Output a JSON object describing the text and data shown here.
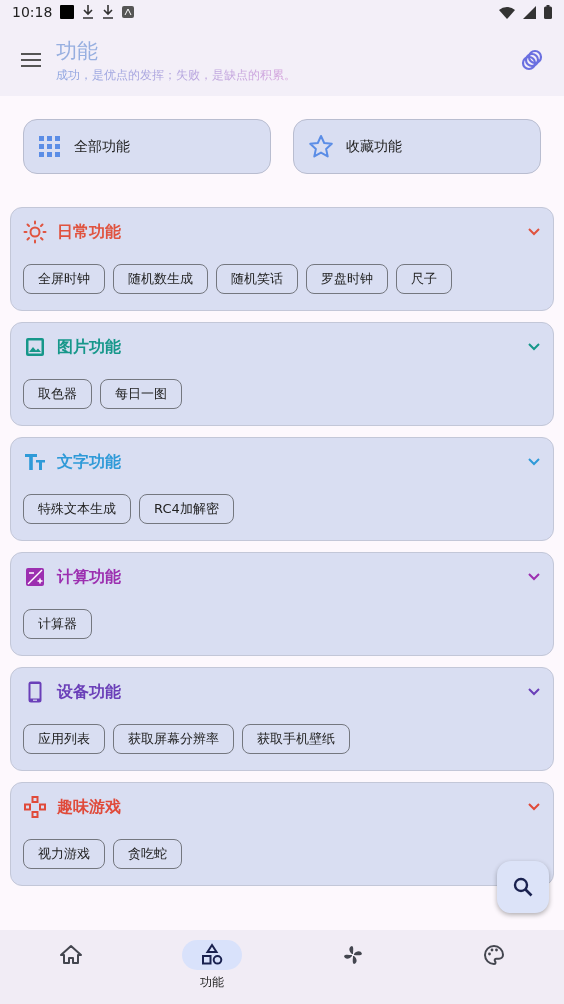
{
  "status_bar": {
    "time": "10:18"
  },
  "header": {
    "title": "功能",
    "subtitle": "成功，是优点的发挥；失败，是缺点的积累。"
  },
  "top_buttons": [
    {
      "kind": "grid",
      "label": "全部功能"
    },
    {
      "kind": "star",
      "label": "收藏功能"
    }
  ],
  "categories": [
    {
      "kind": "sun",
      "title": "日常功能",
      "color": "#e0533f",
      "expanded": true,
      "items": [
        "全屏时钟",
        "随机数生成",
        "随机笑话",
        "罗盘时钟",
        "尺子"
      ]
    },
    {
      "kind": "image",
      "title": "图片功能",
      "color": "#16978a",
      "expanded": true,
      "items": [
        "取色器",
        "每日一图"
      ]
    },
    {
      "kind": "text",
      "title": "文字功能",
      "color": "#2f9ad8",
      "expanded": true,
      "items": [
        "特殊文本生成",
        "RC4加解密"
      ]
    },
    {
      "kind": "calc",
      "title": "计算功能",
      "color": "#9c2fb0",
      "expanded": true,
      "items": [
        "计算器"
      ]
    },
    {
      "kind": "phone",
      "title": "设备功能",
      "color": "#6a3fb8",
      "expanded": true,
      "items": [
        "应用列表",
        "获取屏幕分辨率",
        "获取手机壁纸"
      ]
    },
    {
      "kind": "game",
      "title": "趣味游戏",
      "color": "#e04a3a",
      "expanded": true,
      "items": [
        "视力游戏",
        "贪吃蛇"
      ]
    }
  ],
  "bottom_nav": [
    {
      "kind": "home",
      "selected": false
    },
    {
      "kind": "shapes",
      "label": "功能",
      "selected": true
    },
    {
      "kind": "fan",
      "selected": false
    },
    {
      "kind": "palette",
      "selected": false
    }
  ]
}
